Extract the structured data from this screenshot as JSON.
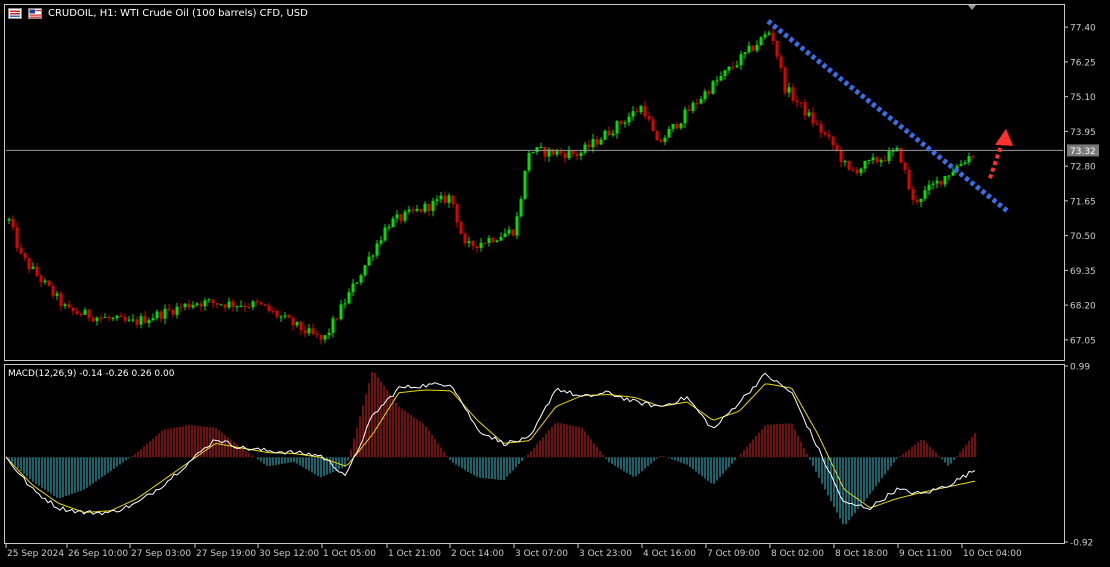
{
  "header": {
    "title": "CRUDOIL, H1:  WTI Crude Oil (100 barrels) CFD, USD",
    "icons": [
      "chart-type-icon",
      "flag-icon"
    ]
  },
  "price_panel": {
    "current_price_label": "73.32",
    "y_ticks": [
      "77.40",
      "76.25",
      "75.10",
      "73.95",
      "72.80",
      "71.65",
      "70.50",
      "69.35",
      "68.20",
      "67.05"
    ]
  },
  "macd_panel": {
    "label": "MACD(12,26,9) -0.14 -0.26 0.26 0.00",
    "y_ticks": [
      "0.99",
      "-0.92"
    ]
  },
  "x_ticks": [
    "25 Sep 2024",
    "26 Sep 10:00",
    "27 Sep 03:00",
    "27 Sep 19:00",
    "30 Sep 12:00",
    "1 Oct 05:00",
    "1 Oct 21:00",
    "2 Oct 14:00",
    "3 Oct 07:00",
    "3 Oct 23:00",
    "4 Oct 16:00",
    "7 Oct 09:00",
    "8 Oct 02:00",
    "8 Oct 18:00",
    "9 Oct 11:00",
    "10 Oct 04:00"
  ],
  "colors": {
    "bull": "#00e000",
    "bear": "#e00000",
    "trendline": "#3a6ee8",
    "arrow": "#ff3030",
    "macd_line": "#ffffff",
    "signal_line": "#e8d800",
    "hist_pos": "#e02020",
    "hist_neg": "#30c8d8",
    "axis": "#cccccc"
  },
  "chart_data": [
    {
      "type": "candlestick",
      "title": "CRUDOIL, H1: WTI Crude Oil (100 barrels) CFD, USD",
      "x_axis": "time",
      "xlabel": "",
      "ylabel": "",
      "ylim": [
        66.45,
        78.1
      ],
      "current_price": 73.32,
      "key_points": [
        {
          "x": "25 Sep 2024",
          "y": 71.0
        },
        {
          "x": "25 Sep 2024",
          "y": 69.8
        },
        {
          "x": "26 Sep 10:00",
          "y": 68.0
        },
        {
          "x": "27 Sep 03:00",
          "y": 67.6
        },
        {
          "x": "27 Sep 19:00",
          "y": 68.3
        },
        {
          "x": "30 Sep 12:00",
          "y": 68.2
        },
        {
          "x": "1 Oct 05:00",
          "y": 67.0
        },
        {
          "x": "1 Oct 21:00",
          "y": 70.9
        },
        {
          "x": "2 Oct 14:00",
          "y": 71.8
        },
        {
          "x": "2 Oct 14:00",
          "y": 70.1
        },
        {
          "x": "3 Oct 07:00",
          "y": 70.7
        },
        {
          "x": "3 Oct 07:00",
          "y": 73.3
        },
        {
          "x": "3 Oct 23:00",
          "y": 73.2
        },
        {
          "x": "4 Oct 16:00",
          "y": 74.8
        },
        {
          "x": "4 Oct 16:00",
          "y": 73.5
        },
        {
          "x": "7 Oct 09:00",
          "y": 75.3
        },
        {
          "x": "8 Oct 02:00",
          "y": 77.3
        },
        {
          "x": "8 Oct 02:00",
          "y": 75.4
        },
        {
          "x": "8 Oct 18:00",
          "y": 73.4
        },
        {
          "x": "8 Oct 18:00",
          "y": 72.6
        },
        {
          "x": "9 Oct 11:00",
          "y": 73.3
        },
        {
          "x": "9 Oct 11:00",
          "y": 71.6
        },
        {
          "x": "10 Oct 04:00",
          "y": 73.32
        }
      ],
      "annotations": [
        {
          "kind": "dotted-trendline",
          "from": {
            "x": "8 Oct 02:00",
            "y": 77.6
          },
          "to": {
            "x": "10 Oct 04:00",
            "y": 71.3
          }
        },
        {
          "kind": "dotted-arrow-up",
          "from": {
            "x": "10 Oct 04:00",
            "y": 72.4
          },
          "to": {
            "x": "10 Oct 04:00",
            "y": 73.9
          }
        }
      ]
    },
    {
      "type": "macd",
      "title": "MACD(12,26,9)",
      "parameters": [
        12,
        26,
        9
      ],
      "values": {
        "main": -0.14,
        "signal": -0.26,
        "histogram": 0.26,
        "zero": 0.0
      },
      "ylim": [
        -0.92,
        0.99
      ],
      "series": [
        {
          "name": "histogram",
          "values": [
            0.0,
            -0.26,
            -0.45,
            -0.35,
            -0.15,
            0.05,
            0.3,
            0.35,
            0.32,
            0.1,
            -0.1,
            -0.05,
            -0.22,
            -0.1,
            0.95,
            0.55,
            0.35,
            -0.05,
            -0.22,
            -0.25,
            0.05,
            0.38,
            0.32,
            -0.05,
            -0.22,
            0.02,
            -0.08,
            -0.3,
            0.02,
            0.35,
            0.37,
            -0.2,
            -0.75,
            -0.4,
            -0.02,
            0.2,
            -0.1,
            0.26
          ]
        },
        {
          "name": "macd",
          "values": [
            0.0,
            -0.35,
            -0.55,
            -0.6,
            -0.6,
            -0.5,
            -0.3,
            -0.05,
            0.2,
            0.1,
            0.07,
            0.05,
            0.02,
            -0.2,
            0.45,
            0.75,
            0.78,
            0.8,
            0.3,
            0.15,
            0.2,
            0.75,
            0.65,
            0.7,
            0.6,
            0.55,
            0.65,
            0.3,
            0.6,
            0.9,
            0.7,
            0.1,
            -0.5,
            -0.55,
            -0.35,
            -0.4,
            -0.3,
            -0.14
          ]
        },
        {
          "name": "signal",
          "values": [
            0.0,
            -0.3,
            -0.5,
            -0.6,
            -0.58,
            -0.45,
            -0.25,
            -0.05,
            0.15,
            0.1,
            0.05,
            0.04,
            0.0,
            -0.1,
            0.25,
            0.7,
            0.73,
            0.72,
            0.4,
            0.15,
            0.18,
            0.55,
            0.67,
            0.68,
            0.65,
            0.55,
            0.6,
            0.4,
            0.5,
            0.8,
            0.75,
            0.25,
            -0.35,
            -0.55,
            -0.45,
            -0.38,
            -0.32,
            -0.26
          ]
        }
      ]
    }
  ]
}
